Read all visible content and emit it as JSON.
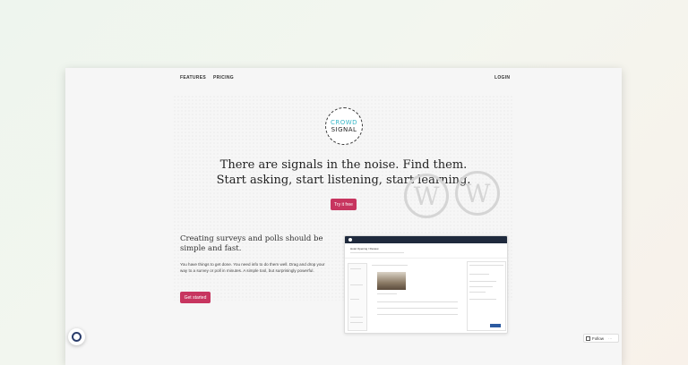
{
  "nav": {
    "features": "FEATURES",
    "pricing": "PRICING",
    "login": "LOGIN"
  },
  "logo": {
    "line1": "CROWD",
    "line2": "SIGNAL"
  },
  "hero": {
    "line1": "There are signals in the noise. Find them.",
    "line2": "Start asking, start listening, start learning.",
    "cta": "Try it free"
  },
  "section": {
    "title": "Creating surveys and polls should be simple and fast.",
    "body": "You have things to get done. You need info to do them well. Drag and drop your way to a survey or poll in minutes. A simple tool, but surprisingly powerful.",
    "cta": "Get started"
  },
  "app_preview": {
    "title": "Hotel Opening / Review"
  },
  "follow": {
    "label": "Follow",
    "more": "···"
  },
  "colors": {
    "accent": "#c7355f",
    "app_bar": "#1f2a3d",
    "logo_teal": "#3ab8c8"
  }
}
